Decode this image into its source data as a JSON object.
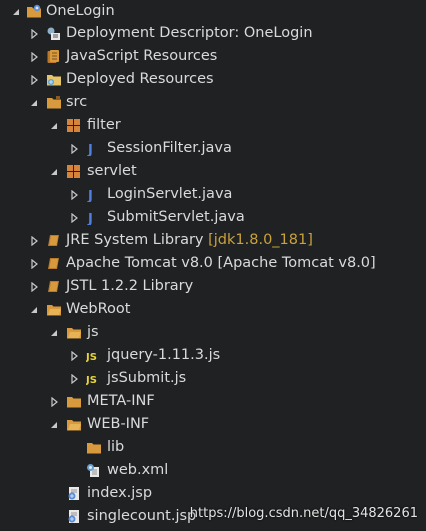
{
  "tree": {
    "items": [
      {
        "label": "OneLogin",
        "icon": "project-icon",
        "expanded": true
      },
      {
        "label": "Deployment Descriptor: OneLogin",
        "icon": "deployment-descriptor-icon",
        "expanded": false
      },
      {
        "label": "JavaScript Resources",
        "icon": "javascript-resources-icon",
        "expanded": false
      },
      {
        "label": "Deployed Resources",
        "icon": "deployed-resources-icon",
        "expanded": false
      },
      {
        "label": "src",
        "icon": "source-folder-icon",
        "expanded": true
      },
      {
        "label": "filter",
        "icon": "package-icon",
        "expanded": true
      },
      {
        "label": "SessionFilter.java",
        "icon": "java-file-icon",
        "expanded": false
      },
      {
        "label": "servlet",
        "icon": "package-icon",
        "expanded": true
      },
      {
        "label": "LoginServlet.java",
        "icon": "java-file-icon",
        "expanded": false
      },
      {
        "label": "SubmitServlet.java",
        "icon": "java-file-icon",
        "expanded": false
      },
      {
        "label": "JRE System Library",
        "decoration": "[jdk1.8.0_181]",
        "icon": "library-icon",
        "expanded": false
      },
      {
        "label": "Apache Tomcat v8.0 [Apache Tomcat v8.0]",
        "icon": "library-icon",
        "expanded": false
      },
      {
        "label": "JSTL 1.2.2 Library",
        "icon": "library-icon",
        "expanded": false
      },
      {
        "label": "WebRoot",
        "icon": "web-folder-icon",
        "expanded": true
      },
      {
        "label": "js",
        "icon": "folder-icon",
        "expanded": true
      },
      {
        "label": "jquery-1.11.3.js",
        "icon": "js-file-icon",
        "expanded": false
      },
      {
        "label": "jsSubmit.js",
        "icon": "js-file-icon",
        "expanded": false
      },
      {
        "label": "META-INF",
        "icon": "folder-icon",
        "expanded": false
      },
      {
        "label": "WEB-INF",
        "icon": "folder-icon",
        "expanded": true
      },
      {
        "label": "lib",
        "icon": "folder-icon"
      },
      {
        "label": "web.xml",
        "icon": "xml-file-icon"
      },
      {
        "label": "index.jsp",
        "icon": "jsp-file-icon"
      },
      {
        "label": "singlecount.jsp",
        "icon": "jsp-file-icon"
      }
    ]
  },
  "watermark": "https://blog.csdn.net/qq_34826261",
  "colors": {
    "background": "#1f2123",
    "text": "#d9dadb",
    "decoration": "#c9a23a",
    "folder": "#d89a3c",
    "package": "#d6843a",
    "java": "#4f7fe0",
    "js": "#e7d43a"
  }
}
